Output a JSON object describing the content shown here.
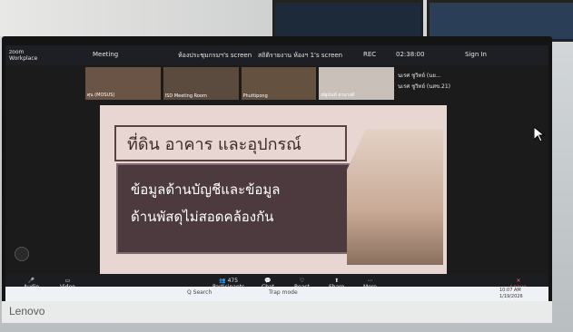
{
  "zoom": {
    "app_name": "zoom\nWorkplace",
    "meeting_label": "Meeting",
    "share_label": "ห้องประชุมกรมฯ's screen",
    "view_label": "สถิติรายงาน ห้องฯ 1's screen",
    "rec_label": "REC",
    "time": "02:38:00",
    "signin": "Sign In",
    "participant_name_1": "นเรศ ชูวิทย์ (นย...",
    "participant_name_2": "นเรศ ชูวิทย์ (นสข.21)",
    "thumbnails": [
      {
        "label": "ศุน (MOSUS)"
      },
      {
        "label": "ISD Meeting Room"
      },
      {
        "label": "Phuttipong"
      },
      {
        "label": "ณัฐนันท์ ตามวงศ์"
      }
    ]
  },
  "slide": {
    "title": "ที่ดิน อาคาร และอุปกรณ์",
    "body_line1": "ข้อมูลด้านบัญชีและข้อมูล",
    "body_line2": "ด้านพัสดุไม่สอดคล้องกัน"
  },
  "toolbar": {
    "audio": "Audio",
    "video": "Video",
    "participants": "Participants",
    "participants_count": "475",
    "chat": "Chat",
    "react": "React",
    "share": "Share",
    "more": "More",
    "leave": "Leave"
  },
  "taskbar": {
    "search": "Q Search",
    "weather": "Trap mode",
    "time": "10:07 AM",
    "date": "1/19/2026"
  },
  "monitor_brand": "Lenovo"
}
